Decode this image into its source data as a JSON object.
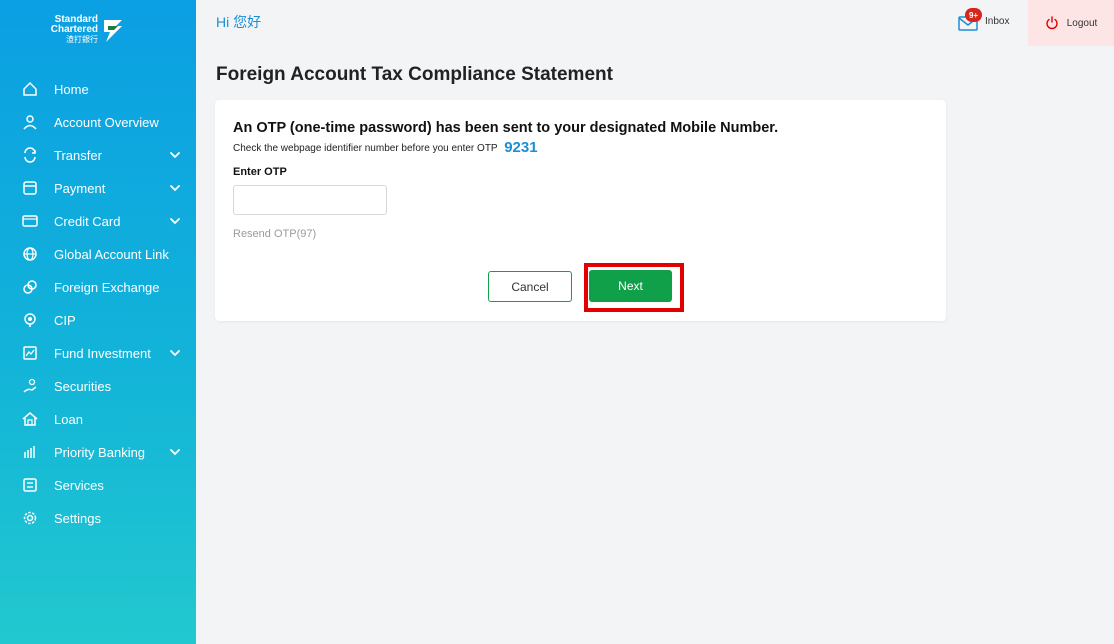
{
  "brand": {
    "line1": "Standard",
    "line2": "Chartered",
    "line3": "渣打銀行"
  },
  "header": {
    "greeting": "Hi 您好",
    "inbox_badge": "9+",
    "inbox_label": "Inbox",
    "logout_label": "Logout"
  },
  "sidebar": {
    "items": [
      {
        "label": "Home",
        "icon": "home-icon",
        "expandable": false
      },
      {
        "label": "Account Overview",
        "icon": "user-icon",
        "expandable": false
      },
      {
        "label": "Transfer",
        "icon": "transfer-icon",
        "expandable": true
      },
      {
        "label": "Payment",
        "icon": "payment-icon",
        "expandable": true
      },
      {
        "label": "Credit Card",
        "icon": "credit-card-icon",
        "expandable": true
      },
      {
        "label": "Global Account Link",
        "icon": "globe-icon",
        "expandable": false
      },
      {
        "label": "Foreign Exchange",
        "icon": "currency-exchange-icon",
        "expandable": false
      },
      {
        "label": "CIP",
        "icon": "cip-icon",
        "expandable": false
      },
      {
        "label": "Fund Investment",
        "icon": "chart-icon",
        "expandable": true
      },
      {
        "label": "Securities",
        "icon": "securities-icon",
        "expandable": false
      },
      {
        "label": "Loan",
        "icon": "loan-house-icon",
        "expandable": false
      },
      {
        "label": "Priority Banking",
        "icon": "priority-banking-icon",
        "expandable": true
      },
      {
        "label": "Services",
        "icon": "services-icon",
        "expandable": false
      },
      {
        "label": "Settings",
        "icon": "gear-icon",
        "expandable": false
      }
    ]
  },
  "main": {
    "title": "Foreign Account Tax Compliance Statement",
    "otp_heading": "An OTP (one-time password) has been sent to your designated Mobile Number.",
    "identifier_text": "Check the webpage identifier number before you enter OTP",
    "identifier_number": "9231",
    "enter_label": "Enter OTP",
    "otp_value": "",
    "otp_placeholder": "",
    "resend_label": "Resend OTP(97)",
    "cancel_label": "Cancel",
    "next_label": "Next"
  },
  "colors": {
    "accent_blue": "#1b8fd6",
    "primary_green": "#11a04a",
    "highlight_red": "#e30000",
    "badge_red": "#d9261c"
  }
}
